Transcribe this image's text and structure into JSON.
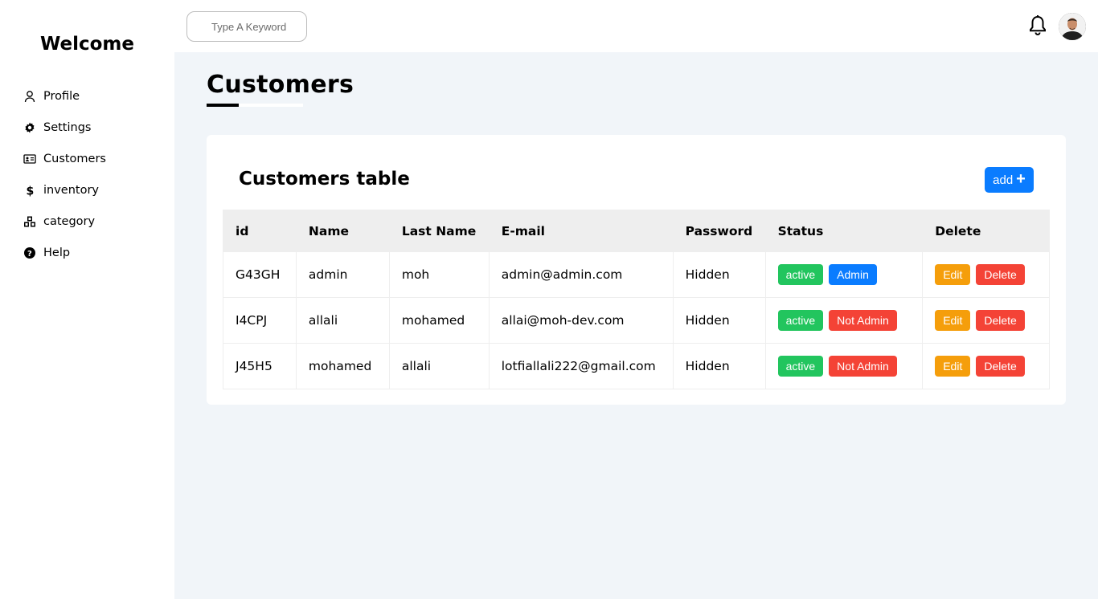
{
  "sidebar": {
    "brand": "Welcome",
    "items": [
      {
        "label": "Profile",
        "icon": "user-icon"
      },
      {
        "label": "Settings",
        "icon": "gear-icon"
      },
      {
        "label": "Customers",
        "icon": "id-card-icon"
      },
      {
        "label": "inventory",
        "icon": "dollar-icon"
      },
      {
        "label": "category",
        "icon": "cubes-icon"
      },
      {
        "label": "Help",
        "icon": "question-circle-icon"
      }
    ]
  },
  "topbar": {
    "search_placeholder": "Type A Keyword"
  },
  "page": {
    "title": "Customers"
  },
  "table_card": {
    "title": "Customers table",
    "add_label": "add",
    "headers": [
      "id",
      "Name",
      "Last Name",
      "E-mail",
      "Password",
      "Status",
      "Delete"
    ],
    "rows": [
      {
        "id": "G43GH",
        "name": "admin",
        "last_name": "moh",
        "email": "admin@admin.com",
        "password": "Hidden",
        "status": "active",
        "role": "Admin",
        "edit": "Edit",
        "delete": "Delete"
      },
      {
        "id": "I4CPJ",
        "name": "allali",
        "last_name": "mohamed",
        "email": "allai@moh-dev.com",
        "password": "Hidden",
        "status": "active",
        "role": "Not Admin",
        "edit": "Edit",
        "delete": "Delete"
      },
      {
        "id": "J45H5",
        "name": "mohamed",
        "last_name": "allali",
        "email": "lotfiallali222@gmail.com",
        "password": "Hidden",
        "status": "active",
        "role": "Not Admin",
        "edit": "Edit",
        "delete": "Delete"
      }
    ]
  },
  "colors": {
    "active": "#22c55e",
    "admin": "#0a7cff",
    "not_admin": "#f44336",
    "edit": "#f59e0b",
    "delete": "#f44336",
    "background": "#f1f5f9"
  }
}
